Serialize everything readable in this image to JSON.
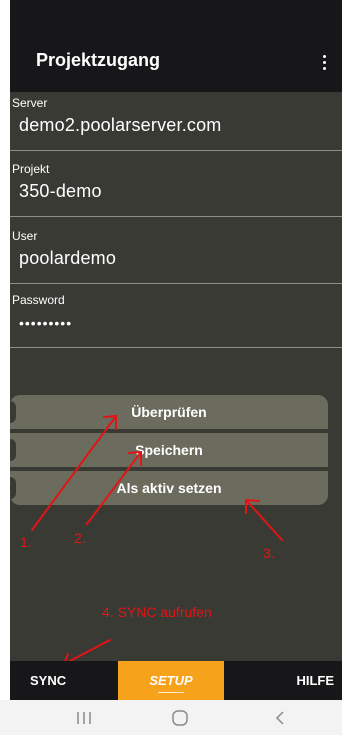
{
  "appbar": {
    "title": "Projektzugang",
    "menu_icon": "more-vert-icon"
  },
  "form": {
    "server": {
      "label": "Server",
      "value": "demo2.poolarserver.com"
    },
    "projekt": {
      "label": "Projekt",
      "value": "350-demo"
    },
    "user": {
      "label": "User",
      "value": "poolardemo"
    },
    "password": {
      "label": "Password",
      "value": "•••••••••"
    }
  },
  "buttons": {
    "check": "Überprüfen",
    "save": "Speichern",
    "activate": "Als aktiv setzen"
  },
  "annotations": {
    "one": "1.",
    "two": "2.",
    "three": "3.",
    "four": "4. SYNC aufrufen",
    "color": "#e31414"
  },
  "tabs": {
    "sync": "SYNC",
    "setup": "SETUP",
    "hilfe": "HILFE",
    "active_color": "#f7a21b"
  },
  "navbar": {
    "recent": "recent-apps-icon",
    "home": "home-icon",
    "back": "back-icon"
  }
}
